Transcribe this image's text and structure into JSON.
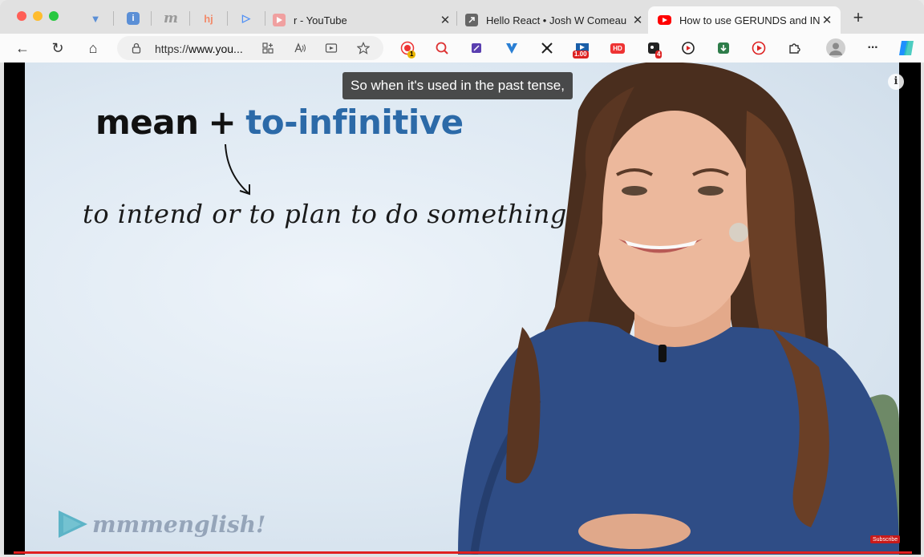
{
  "window": {
    "title": "How to use GERUNDS and INF"
  },
  "tabs": {
    "pinned": [
      {
        "name": "vee-tab",
        "glyph": "▼",
        "color": "#5b8fd6"
      },
      {
        "name": "info-tab",
        "glyph": "i",
        "color": "#5b8fd6"
      },
      {
        "name": "m-tab",
        "glyph": "m",
        "color": "#999999"
      },
      {
        "name": "hj-tab",
        "glyph": "hj",
        "color": "#f28b6b"
      },
      {
        "name": "d-tab",
        "glyph": "▷",
        "color": "#4e8ff5"
      }
    ],
    "items": [
      {
        "title": "r - YouTube",
        "close": "✕"
      },
      {
        "title": "Hello React • Josh W Comeau",
        "close": "✕"
      },
      {
        "title": "How to use GERUNDS and INF",
        "close": "✕"
      }
    ],
    "new_tab": "+"
  },
  "toolbar": {
    "back": "←",
    "reload": "↻",
    "home": "⌂",
    "url_prefix": "https://",
    "url_domain": "www.you...",
    "more": "···",
    "badges": {
      "ext1": "1",
      "ext2": "1.00",
      "ext3": "HD",
      "ext4": "4"
    }
  },
  "video": {
    "caption": "So when it's used in the past tense,",
    "info": "i",
    "heading_keyword": "mean",
    "heading_plus": "+",
    "heading_target": "to-infinitive",
    "definition": "to intend or to plan to do something",
    "logo": "mmmenglish!",
    "subscribe": "Subscribe"
  },
  "colors": {
    "accent_blue": "#2c6aa8",
    "progress_red": "#e02020",
    "youtube_red": "#ff0000"
  }
}
